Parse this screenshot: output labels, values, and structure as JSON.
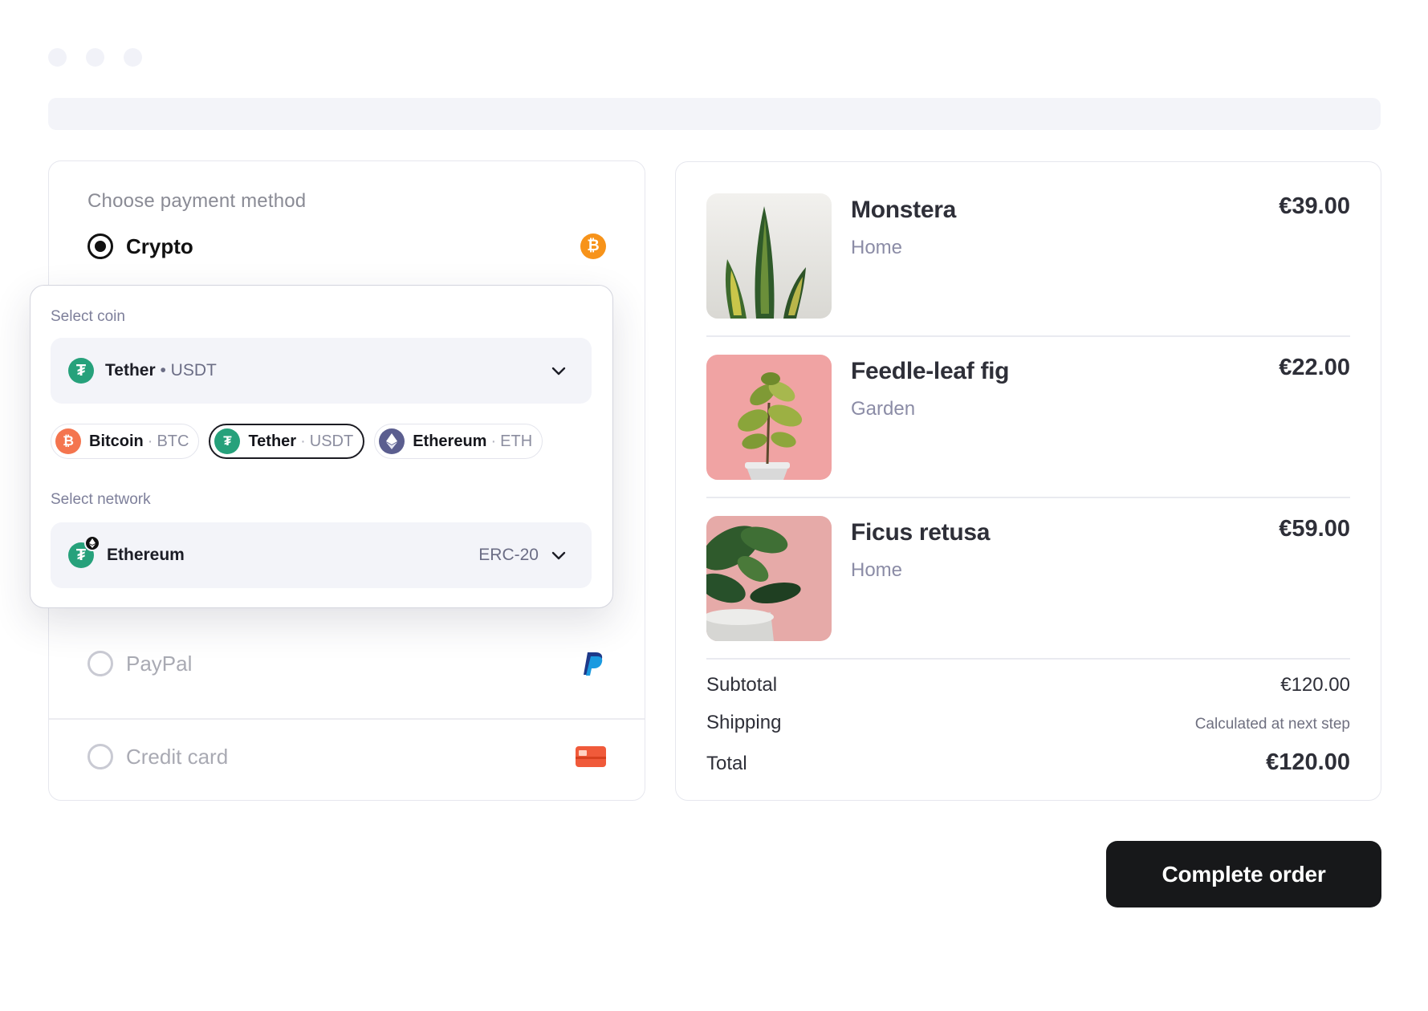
{
  "payment": {
    "title": "Choose payment method",
    "methods": [
      {
        "label": "Crypto",
        "selected": true,
        "icon": "bitcoin-icon"
      },
      {
        "label": "PayPal",
        "selected": false,
        "icon": "paypal-icon"
      },
      {
        "label": "Credit card",
        "selected": false,
        "icon": "credit-card-icon"
      }
    ],
    "crypto": {
      "coin_label": "Select coin",
      "selected_coin": {
        "name": "Tether",
        "sep": "•",
        "symbol": "USDT"
      },
      "coins": [
        {
          "name": "Bitcoin",
          "symbol": "BTC",
          "icon": "bitcoin-icon",
          "color": "#f4754f"
        },
        {
          "name": "Tether",
          "symbol": "USDT",
          "icon": "tether-icon",
          "color": "#26a17b",
          "selected": true
        },
        {
          "name": "Ethereum",
          "symbol": "ETH",
          "icon": "ethereum-icon",
          "color": "#5b5e8f"
        }
      ],
      "network_label": "Select network",
      "selected_network": {
        "name": "Ethereum",
        "code": "ERC-20"
      }
    }
  },
  "cart": {
    "items": [
      {
        "name": "Monstera",
        "category": "Home",
        "price": "€39.00"
      },
      {
        "name": "Feedle-leaf fig",
        "category": "Garden",
        "price": "€22.00"
      },
      {
        "name": "Ficus retusa",
        "category": "Home",
        "price": "€59.00"
      }
    ],
    "summary": {
      "subtotal_label": "Subtotal",
      "subtotal": "€120.00",
      "shipping_label": "Shipping",
      "shipping": "Calculated at next step",
      "total_label": "Total",
      "total": "€120.00"
    }
  },
  "actions": {
    "complete_label": "Complete order"
  },
  "colors": {
    "accent": "#17181a",
    "tether": "#26a17b",
    "bitcoin": "#f7931a"
  }
}
